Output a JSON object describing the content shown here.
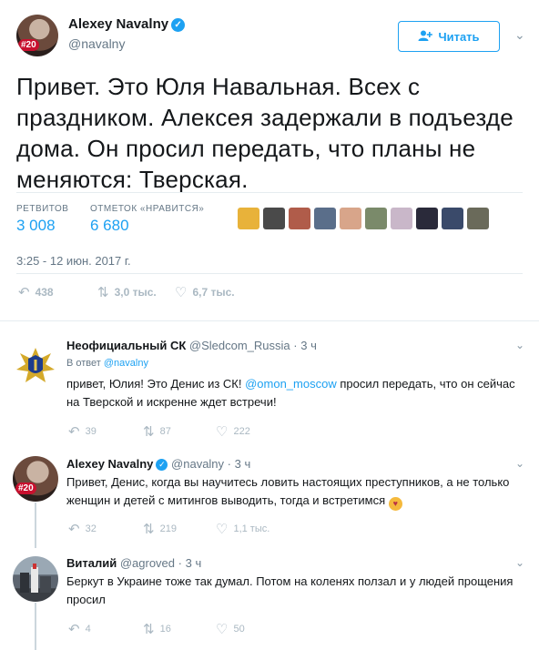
{
  "main_tweet": {
    "author_name": "Alexey Navalny",
    "handle": "@navalny",
    "avatar_badge": "#20",
    "follow_label": "Читать",
    "text": "Привет. Это Юля Навальная. Всех с праздником. Алексея задержали в подъезде дома. Он просил передать, что планы не меняются: Тверская.",
    "retweets_label": "РЕТВИТОВ",
    "retweets_count": "3 008",
    "likes_label": "ОТМЕТОК «НРАВИТСЯ»",
    "likes_count": "6 680",
    "liker_colors": [
      "#e8b23a",
      "#4a4a4a",
      "#b05c4a",
      "#5a6e8a",
      "#d8a58a",
      "#7a8a6a",
      "#c9b7c9",
      "#2a2a3a",
      "#3a4a6a",
      "#6a6a5a"
    ],
    "timestamp": "3:25 - 12 июн. 2017 г.",
    "reply_count": "438",
    "retweet_action_count": "3,0 тыс.",
    "like_action_count": "6,7 тыс."
  },
  "replies": [
    {
      "author_name": "Неофициальный СК",
      "handle": "@Sledcom_Russia",
      "time": "3 ч",
      "in_reply_prefix": "В ответ",
      "in_reply_handle": "@navalny",
      "text_before": "привет, Юлия! Это Денис из СК! ",
      "mention": "@omon_moscow",
      "text_after": " просил передать, что он сейчас на Тверской и искренне ждет встречи!",
      "reply_count": "39",
      "retweet_count": "87",
      "like_count": "222"
    },
    {
      "author_name": "Alexey Navalny",
      "handle": "@navalny",
      "time": "3 ч",
      "avatar_badge": "#20",
      "text": "Привет, Денис, когда вы научитесь ловить настоящих преступников, а не только женщин и детей с митингов выводить, тогда и встретимся",
      "reply_count": "32",
      "retweet_count": "219",
      "like_count": "1,1 тыс."
    },
    {
      "author_name": "Виталий",
      "handle": "@agroved",
      "time": "3 ч",
      "text": "Беркут в Украине тоже так думал. Потом на коленях ползал и у людей прощения просил",
      "reply_count": "4",
      "retweet_count": "16",
      "like_count": "50"
    }
  ],
  "icons": {
    "verified": "verified-badge-icon",
    "follow": "add-user-icon",
    "reply": "reply-icon",
    "retweet": "retweet-icon",
    "like": "heart-icon",
    "more": "chevron-down-icon"
  },
  "colors": {
    "accent": "#1da1f2",
    "text_secondary": "#657786",
    "icon_muted": "#aab8c2",
    "divider": "#e6ecf0"
  }
}
